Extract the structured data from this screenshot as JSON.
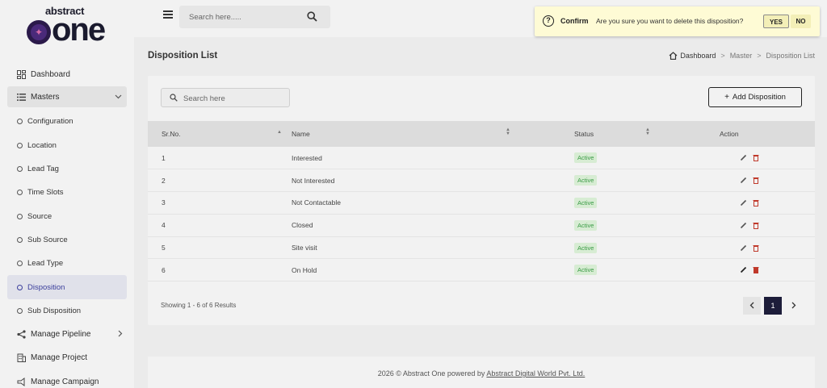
{
  "brand": {
    "logo_top": "abstract",
    "logo_main": "one"
  },
  "sidebar": {
    "items": [
      {
        "label": "Dashboard",
        "icon": "dashboard-icon"
      },
      {
        "label": "Masters",
        "icon": "list-icon"
      }
    ],
    "sub_items": [
      {
        "label": "Configuration"
      },
      {
        "label": "Location"
      },
      {
        "label": "Lead Tag"
      },
      {
        "label": "Time Slots"
      },
      {
        "label": "Source"
      },
      {
        "label": "Sub Source"
      },
      {
        "label": "Lead Type"
      },
      {
        "label": "Disposition"
      },
      {
        "label": "Sub Disposition"
      }
    ],
    "bottom_items": [
      {
        "label": "Manage Pipeline",
        "icon": "share-icon"
      },
      {
        "label": "Manage Project",
        "icon": "building-icon"
      },
      {
        "label": "Manage Campaign",
        "icon": "megaphone-icon"
      }
    ]
  },
  "header": {
    "search_placeholder": "Search here....."
  },
  "confirm": {
    "title": "Confirm",
    "message": "Are you sure you want to delete this disposition?",
    "yes_label": "YES",
    "no_label": "NO"
  },
  "page": {
    "title": "Disposition List",
    "breadcrumb": [
      "Dashboard",
      "Master",
      "Disposition List"
    ]
  },
  "card": {
    "search_placeholder": "Search here",
    "add_button": "Add Disposition",
    "columns": [
      "Sr.No.",
      "Name",
      "Status",
      "Action"
    ],
    "rows": [
      {
        "sr": "1",
        "name": "Interested",
        "status": "Active"
      },
      {
        "sr": "2",
        "name": "Not Interested",
        "status": "Active"
      },
      {
        "sr": "3",
        "name": "Not Contactable",
        "status": "Active"
      },
      {
        "sr": "4",
        "name": "Closed",
        "status": "Active"
      },
      {
        "sr": "5",
        "name": "Site visit",
        "status": "Active"
      },
      {
        "sr": "6",
        "name": "On Hold",
        "status": "Active"
      }
    ],
    "showing": "Showing 1 - 6 of 6 Results",
    "current_page": "1"
  },
  "footer": {
    "text": "2026 © Abstract One powered by ",
    "link": "Abstract Digital World Pvt. Ltd."
  },
  "colors": {
    "accent": "#1d1d3a",
    "active_badge_bg": "#d7ecd3",
    "active_badge_text": "#3a9b45",
    "delete_icon": "#c0392b"
  }
}
